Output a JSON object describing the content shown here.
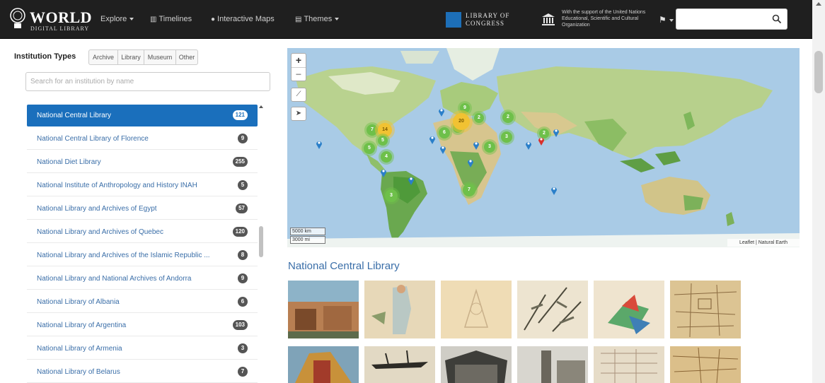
{
  "navbar": {
    "brand_main": "WORLD",
    "brand_sub": "DIGITAL LIBRARY",
    "items": [
      {
        "label": "Explore",
        "icon": "",
        "dropdown": true
      },
      {
        "label": "Timelines",
        "icon": "bar-chart-icon",
        "dropdown": false
      },
      {
        "label": "Interactive Maps",
        "icon": "globe-icon",
        "dropdown": false
      },
      {
        "label": "Themes",
        "icon": "book-icon",
        "dropdown": true
      }
    ],
    "loc_line1": "LIBRARY OF",
    "loc_line2": "CONGRESS",
    "unesco_text": "With the support of the United Nations Educational, Scientific and Cultural Organization",
    "search": {
      "value": "",
      "placeholder": ""
    }
  },
  "sidebar": {
    "institution_types_label": "Institution Types",
    "type_filters": [
      "Archive",
      "Library",
      "Museum",
      "Other"
    ],
    "search_placeholder": "Search for an institution by name",
    "institutions": [
      {
        "name": "National Central Library",
        "count": "121",
        "active": true
      },
      {
        "name": "National Central Library of Florence",
        "count": "9",
        "active": false
      },
      {
        "name": "National Diet Library",
        "count": "255",
        "active": false
      },
      {
        "name": "National Institute of Anthropology and History INAH",
        "count": "5",
        "active": false
      },
      {
        "name": "National Library and Archives of Egypt",
        "count": "57",
        "active": false
      },
      {
        "name": "National Library and Archives of Quebec",
        "count": "120",
        "active": false
      },
      {
        "name": "National Library and Archives of the Islamic Republic ...",
        "count": "8",
        "active": false
      },
      {
        "name": "National Library and National Archives of Andorra",
        "count": "9",
        "active": false
      },
      {
        "name": "National Library of Albania",
        "count": "6",
        "active": false
      },
      {
        "name": "National Library of Argentina",
        "count": "103",
        "active": false
      },
      {
        "name": "National Library of Armenia",
        "count": "3",
        "active": false
      },
      {
        "name": "National Library of Belarus",
        "count": "7",
        "active": false
      }
    ]
  },
  "map": {
    "zoom_in": "+",
    "zoom_out": "−",
    "scale_km": "5000 km",
    "scale_mi": "3000 mi",
    "attribution": "Leaflet | Natural Earth",
    "clusters": [
      "7",
      "14",
      "5",
      "4",
      "5",
      "3",
      "9",
      "6",
      "4",
      "20",
      "2",
      "3",
      "2",
      "3",
      "7",
      "2"
    ]
  },
  "gallery": {
    "title": "National Central Library"
  },
  "colors": {
    "navbar_bg": "#1f1f1f",
    "active_item": "#1a6fbc",
    "link": "#3a6ea8",
    "cluster_green": "#6ec04a",
    "cluster_yellow": "#f1c232",
    "pin_blue": "#2a7fc9",
    "pin_red": "#d9302c"
  }
}
